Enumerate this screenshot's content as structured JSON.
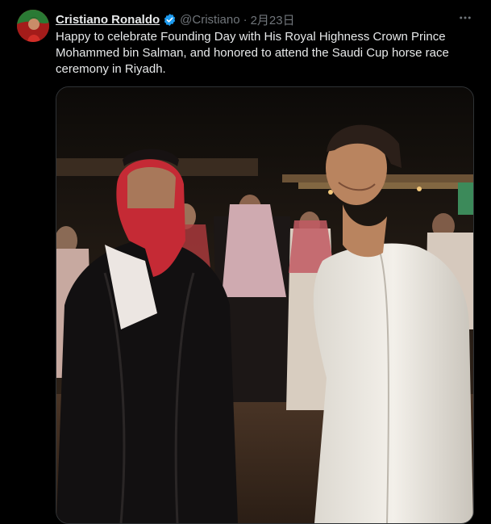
{
  "tweet": {
    "author": {
      "display_name": "Cristiano Ronaldo",
      "handle": "@Cristiano",
      "verified": true,
      "avatar_icon": "profile-avatar"
    },
    "separator": "·",
    "date": "2月23日",
    "text": "Happy to celebrate Founding Day with His Royal Highness Crown Prince Mohammed bin Salman, and honored to attend the Saudi Cup horse race ceremony in Riyadh.",
    "more_icon": "more-horizontal-icon",
    "media": {
      "type": "photo"
    }
  },
  "colors": {
    "background": "#000000",
    "text_primary": "#e7e9ea",
    "text_secondary": "#71767b",
    "verified_blue": "#1d9bf0",
    "media_border": "#2f3336"
  }
}
